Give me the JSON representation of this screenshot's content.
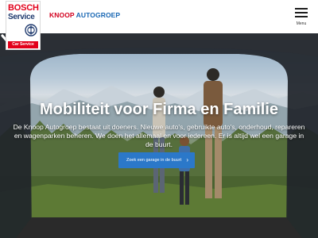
{
  "header": {
    "logo": {
      "brand": "BOSCH",
      "service": "Service",
      "bar_text": "Car Service"
    },
    "company": {
      "part1": "KNOOP",
      "part2": "AUTOGROEP"
    },
    "menu_label": "Menu",
    "menu_icon": "hamburger-icon"
  },
  "hero": {
    "title": "Mobiliteit voor Firma en Familie",
    "text": "De Knoop Autogroep bestaat uit doeners. Nieuwe auto's, gebruikte auto's, onderhoud, repareren en wagenparken beheren. We doen het allemaal en voor iedereen. Er is altijd wel een garage in de buurt.",
    "cta_label": "Zoek een garage in de buurt",
    "cta_icon": "chevron-right-icon",
    "scroll_icon": "chevron-down-icon"
  },
  "colors": {
    "bosch_red": "#e2001a",
    "brand_blue": "#1766b3",
    "cta_blue": "#2b78c9"
  }
}
